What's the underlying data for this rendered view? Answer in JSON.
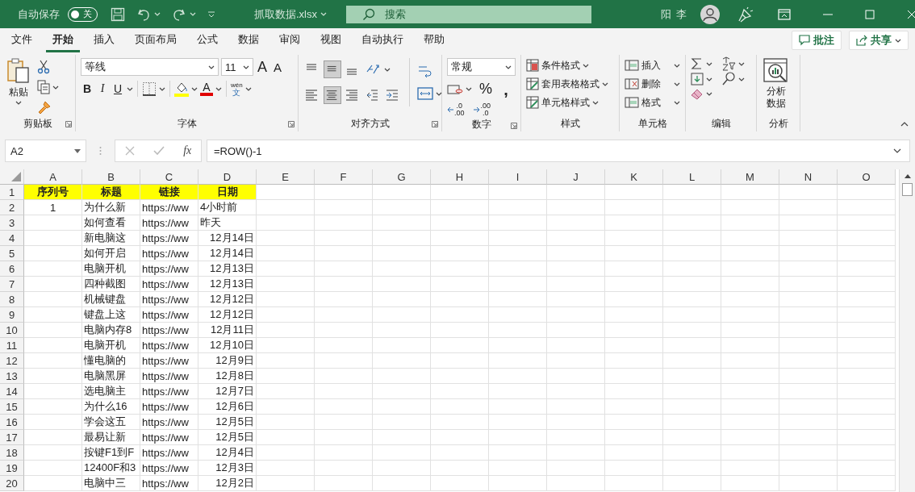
{
  "title_bar": {
    "autosave_label": "自动保存",
    "autosave_toggle": {
      "label": "关",
      "on": false
    },
    "filename": "抓取数据.xlsx",
    "search": {
      "placeholder": "搜索"
    },
    "user": "阳 李"
  },
  "menu_tabs": [
    {
      "label": "文件",
      "selected": false
    },
    {
      "label": "开始",
      "selected": true
    },
    {
      "label": "插入",
      "selected": false
    },
    {
      "label": "页面布局",
      "selected": false
    },
    {
      "label": "公式",
      "selected": false
    },
    {
      "label": "数据",
      "selected": false
    },
    {
      "label": "审阅",
      "selected": false
    },
    {
      "label": "视图",
      "selected": false
    },
    {
      "label": "自动执行",
      "selected": false
    },
    {
      "label": "帮助",
      "selected": false
    }
  ],
  "comment_button": "批注",
  "share_button": "共享",
  "ribbon": {
    "clipboard": {
      "paste": "粘贴",
      "label": "剪贴板",
      "launcher": true
    },
    "font": {
      "font_name": "等线",
      "font_size": "11",
      "grow": "A",
      "shrink": "A",
      "bold": "B",
      "italic": "I",
      "underline": "U",
      "font_color": "A",
      "phonetic_top": "wén",
      "phonetic_bottom": "文",
      "label": "字体",
      "launcher": true
    },
    "alignment": {
      "rows": [
        [
          {
            "kind": "top",
            "selected": false
          },
          {
            "kind": "middle",
            "selected": true
          },
          {
            "kind": "bottom",
            "selected": false
          },
          {
            "kind": "orientation",
            "selected": false
          }
        ],
        [
          {
            "kind": "left",
            "selected": false
          },
          {
            "kind": "center",
            "selected": true
          },
          {
            "kind": "right",
            "selected": false
          },
          {
            "kind": "outdent",
            "selected": false
          },
          {
            "kind": "indent",
            "selected": false
          }
        ]
      ],
      "label": "对齐方式",
      "launcher": true
    },
    "number": {
      "format": "常规",
      "percent": "%",
      "comma": ",",
      "decimals": [
        {
          "top": ".0",
          "bottom": ".00"
        },
        {
          "top": ".00",
          "bottom": ".0"
        }
      ],
      "label": "数字",
      "launcher": true
    },
    "styles": {
      "items": [
        "条件格式",
        "套用表格格式",
        "单元格样式"
      ],
      "label": "样式"
    },
    "cells": {
      "items": [
        "插入",
        "删除",
        "格式"
      ],
      "label": "单元格"
    },
    "editing": {
      "label": "编辑"
    },
    "analysis": {
      "button": "分析数据",
      "label": "分析"
    }
  },
  "formula_bar": {
    "name_box": "A2",
    "fx": "fx",
    "formula": "=ROW()-1"
  },
  "sheet": {
    "columns": [
      "A",
      "B",
      "C",
      "D",
      "E",
      "F",
      "G",
      "H",
      "I",
      "J",
      "K",
      "L",
      "M",
      "N",
      "O"
    ],
    "rows": [
      {
        "number": "1",
        "kind": "header",
        "cells": [
          "序列号",
          "标题",
          "链接",
          "日期"
        ]
      },
      {
        "number": "2",
        "kind": "text_date",
        "cells": [
          "1",
          "为什么新",
          "https://ww",
          "4小时前"
        ]
      },
      {
        "number": "3",
        "kind": "text_date",
        "cells": [
          "",
          "如何查看",
          "https://ww",
          "昨天"
        ]
      },
      {
        "number": "4",
        "kind": "date",
        "cells": [
          "",
          "新电脑这",
          "https://ww",
          "12月14日"
        ]
      },
      {
        "number": "5",
        "kind": "date",
        "cells": [
          "",
          "如何开启",
          "https://ww",
          "12月14日"
        ]
      },
      {
        "number": "6",
        "kind": "date",
        "cells": [
          "",
          "电脑开机",
          "https://ww",
          "12月13日"
        ]
      },
      {
        "number": "7",
        "kind": "date",
        "cells": [
          "",
          "四种截图",
          "https://ww",
          "12月13日"
        ]
      },
      {
        "number": "8",
        "kind": "date",
        "cells": [
          "",
          "机械键盘",
          "https://ww",
          "12月12日"
        ]
      },
      {
        "number": "9",
        "kind": "date",
        "cells": [
          "",
          "键盘上这",
          "https://ww",
          "12月12日"
        ]
      },
      {
        "number": "10",
        "kind": "date",
        "cells": [
          "",
          "电脑内存8",
          "https://ww",
          "12月11日"
        ]
      },
      {
        "number": "11",
        "kind": "date",
        "cells": [
          "",
          "电脑开机",
          "https://ww",
          "12月10日"
        ]
      },
      {
        "number": "12",
        "kind": "date",
        "cells": [
          "",
          "懂电脑的",
          "https://ww",
          "12月9日"
        ]
      },
      {
        "number": "13",
        "kind": "date",
        "cells": [
          "",
          "电脑黑屏",
          "https://ww",
          "12月8日"
        ]
      },
      {
        "number": "14",
        "kind": "date",
        "cells": [
          "",
          "选电脑主",
          "https://ww",
          "12月7日"
        ]
      },
      {
        "number": "15",
        "kind": "date",
        "cells": [
          "",
          "为什么16",
          "https://ww",
          "12月6日"
        ]
      },
      {
        "number": "16",
        "kind": "date",
        "cells": [
          "",
          "学会这五",
          "https://ww",
          "12月5日"
        ]
      },
      {
        "number": "17",
        "kind": "date",
        "cells": [
          "",
          "最易让新",
          "https://ww",
          "12月5日"
        ]
      },
      {
        "number": "18",
        "kind": "date",
        "cells": [
          "",
          "按键F1到F",
          "https://ww",
          "12月4日"
        ]
      },
      {
        "number": "19",
        "kind": "date",
        "cells": [
          "",
          "12400F和3",
          "https://ww",
          "12月3日"
        ]
      },
      {
        "number": "20",
        "kind": "date",
        "cells": [
          "",
          "电脑中三",
          "https://ww",
          "12月2日"
        ]
      }
    ]
  }
}
